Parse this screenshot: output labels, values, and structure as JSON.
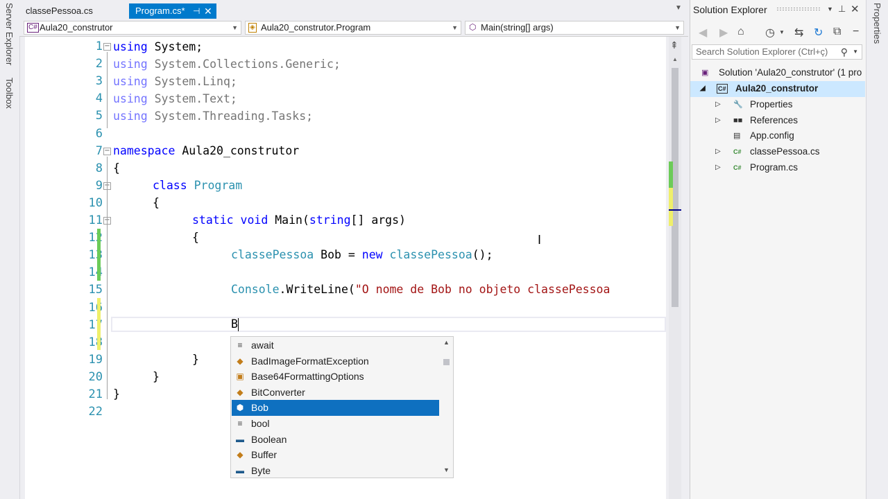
{
  "left_strip": {
    "server_explorer": "Server Explorer",
    "toolbox": "Toolbox"
  },
  "right_strip": {
    "properties": "Properties"
  },
  "tabs": [
    {
      "label": "classePessoa.cs",
      "active": false
    },
    {
      "label": "Program.cs*",
      "active": true
    }
  ],
  "navbar": {
    "project": "Aula20_construtor",
    "class": "Aula20_construtor.Program",
    "member": "Main(string[] args)"
  },
  "editor": {
    "line_numbers": [
      "1",
      "2",
      "3",
      "4",
      "5",
      "6",
      "7",
      "8",
      "9",
      "10",
      "11",
      "12",
      "13",
      "14",
      "15",
      "16",
      "17",
      "18",
      "19",
      "20",
      "21",
      "22"
    ],
    "lines": {
      "l1_kw": "using",
      "l1_rest": " System;",
      "l2_kw": "using",
      "l2_rest": " System.Collections.Generic;",
      "l3_kw": "using",
      "l3_rest": " System.Linq;",
      "l4_kw": "using",
      "l4_rest": " System.Text;",
      "l5_kw": "using",
      "l5_rest": " System.Threading.Tasks;",
      "l7_kw": "namespace",
      "l7_rest": " Aula20_construtor",
      "l8": "{",
      "l9_kw": "class",
      "l9_ty": "Program",
      "l10": "{",
      "l11_kw1": "static",
      "l11_kw2": "void",
      "l11_name": "Main(",
      "l11_kw3": "string",
      "l11_rest": "[] args)",
      "l12": "{",
      "l13_ty1": "classePessoa",
      "l13_mid": " Bob = ",
      "l13_kw": "new",
      "l13_ty2": "classePessoa",
      "l13_end": "();",
      "l15_ty": "Console",
      "l15_mid": ".WriteLine(",
      "l15_str": "\"O nome de Bob no objeto classePessoa",
      "l17": "B",
      "l19": "}",
      "l20": "}",
      "l21": "}"
    }
  },
  "completion": {
    "items": [
      {
        "icon": "keyword-icon",
        "glyph": "≡",
        "label": "await"
      },
      {
        "icon": "class-icon",
        "glyph": "◆",
        "label": "BadImageFormatException"
      },
      {
        "icon": "enum-icon",
        "glyph": "▣",
        "label": "Base64FormattingOptions"
      },
      {
        "icon": "class-icon",
        "glyph": "◆",
        "label": "BitConverter"
      },
      {
        "icon": "local-variable-icon",
        "glyph": "⬢",
        "label": "Bob",
        "selected": true
      },
      {
        "icon": "keyword-icon",
        "glyph": "≡",
        "label": "bool"
      },
      {
        "icon": "struct-icon",
        "glyph": "▬",
        "label": "Boolean"
      },
      {
        "icon": "class-icon",
        "glyph": "◆",
        "label": "Buffer"
      },
      {
        "icon": "struct-icon",
        "glyph": "▬",
        "label": "Byte"
      }
    ]
  },
  "solution_explorer": {
    "title": "Solution Explorer",
    "search_placeholder": "Search Solution Explorer (Ctrl+ç)",
    "solution": "Solution 'Aula20_construtor' (1 pro",
    "project": "Aula20_construtor",
    "items": [
      {
        "label": "Properties",
        "icon": "wrench-icon"
      },
      {
        "label": "References",
        "icon": "references-icon"
      },
      {
        "label": "App.config",
        "icon": "config-file-icon"
      },
      {
        "label": "classePessoa.cs",
        "icon": "csharp-file-icon"
      },
      {
        "label": "Program.cs",
        "icon": "csharp-file-icon"
      }
    ]
  },
  "colors": {
    "accent": "#007acc",
    "selection": "#0e70c0",
    "keyword": "#0000ff",
    "type": "#2b91af",
    "string": "#a31515"
  }
}
